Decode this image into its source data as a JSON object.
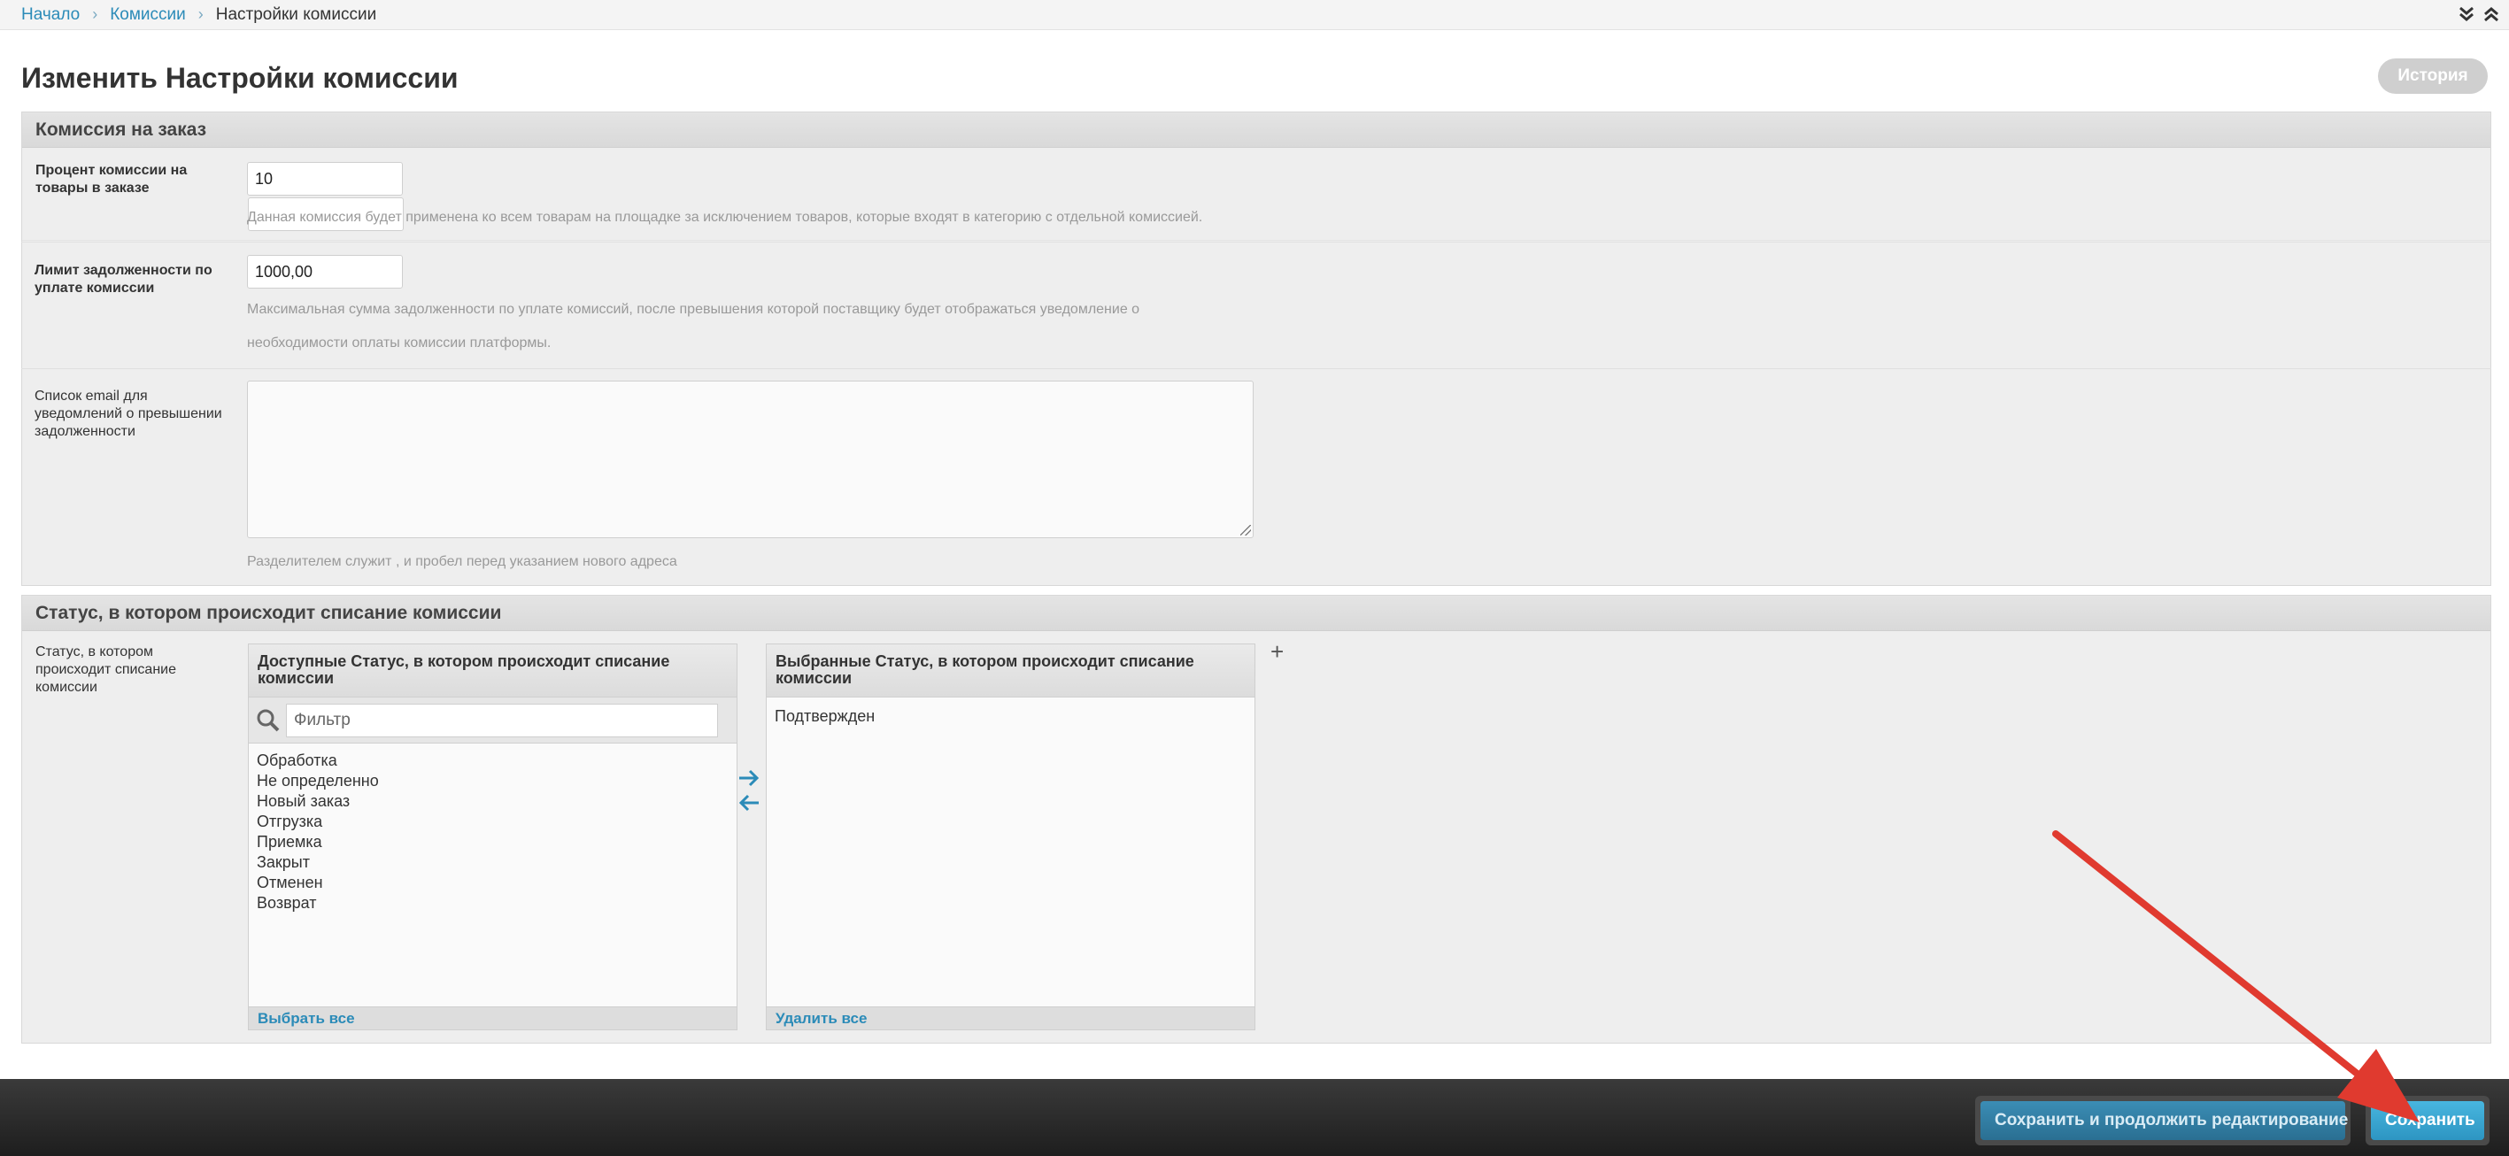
{
  "breadcrumb": {
    "home": "Начало",
    "section": "Комиссии",
    "current": "Настройки комиссии"
  },
  "page": {
    "title": "Изменить Настройки комиссии",
    "history_button": "История"
  },
  "order_commission": {
    "legend": "Комиссия на заказ",
    "percent": {
      "label": "Процент комиссии на товары в заказе",
      "value": "10",
      "help": "Данная комиссия будет применена ко всем товарам на площадке за исключением товаров, которые входят в категорию с отдельной комиссией."
    },
    "debt_limit": {
      "label": "Лимит задолженности по уплате комиссии",
      "value": "1000,00",
      "help_line1": "Максимальная сумма задолженности по уплате комиссий, после превышения которой поставщику будет отображаться уведомление о",
      "help_line2": "необходимости оплаты комиссии платформы."
    },
    "emails": {
      "label": "Список email для уведомлений о превышении задолженности",
      "value": "",
      "help": "Разделителем служит , и пробел перед указанием нового адреса"
    }
  },
  "status_section": {
    "legend": "Статус, в котором происходит списание комиссии",
    "label": "Статус, в котором происходит списание комиссии",
    "available": {
      "title": "Доступные Статус, в котором происходит списание комиссии",
      "filter_placeholder": "Фильтр",
      "items": [
        "Обработка",
        "Не определенно",
        "Новый заказ",
        "Отгрузка",
        "Приемка",
        "Закрыт",
        "Отменен",
        "Возврат"
      ],
      "footer": "Выбрать все"
    },
    "chosen": {
      "title": "Выбранные Статус, в котором происходит списание комиссии",
      "items": [
        "Подтвержден"
      ],
      "footer": "Удалить все"
    },
    "add_symbol": "+"
  },
  "actions": {
    "save_continue": "Сохранить и продолжить редактирование",
    "save": "Сохранить"
  },
  "colors": {
    "link": "#2b8bb8",
    "primary_button": "#2d95c2",
    "annotation_arrow": "#e03a2f"
  },
  "icons": {
    "collapse": [
      "chevron-double-down-icon",
      "chevron-double-up-icon"
    ],
    "filter": "search-icon",
    "move": [
      "arrow-right-icon",
      "arrow-left-icon"
    ]
  }
}
